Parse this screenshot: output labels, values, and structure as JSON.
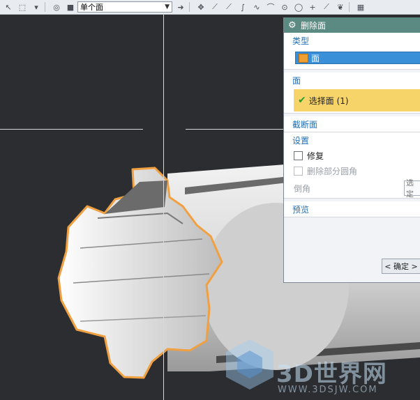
{
  "toolbar": {
    "selection_filter": "单个面",
    "icons": [
      "arrow-icon",
      "box-select-icon",
      "dropdown-icon",
      "render-icon",
      "cube-icon",
      "forward-arrow-icon",
      "snap-point-icon",
      "line-icon",
      "line2-icon",
      "curve-icon",
      "node-icon",
      "arc-icon",
      "circle-icon",
      "target-icon",
      "plus-icon",
      "diagonal-icon",
      "leaf-icon",
      "grid-icon"
    ]
  },
  "dialog": {
    "title": "删除面",
    "type_section": "类型",
    "type_value": "面",
    "face_section": "面",
    "face_select": "选择面 (1)",
    "cut_face_section": "截断面",
    "settings_section": "设置",
    "repair_label": "修复",
    "delete_partial_label": "删除部分圆角",
    "chamfer_label": "倒角",
    "chamfer_button": "选定",
    "preview_section": "预览",
    "ok_button": "< 确定 >"
  },
  "watermark": {
    "brand": "3D世界网",
    "url": "WWW.3DSJW.COM"
  },
  "colors": {
    "dialog_title_bg": "#5a8a82",
    "section_head": "#1f6fb5",
    "selected_face": "#f7d46a",
    "highlight_edge": "#f0a040"
  }
}
